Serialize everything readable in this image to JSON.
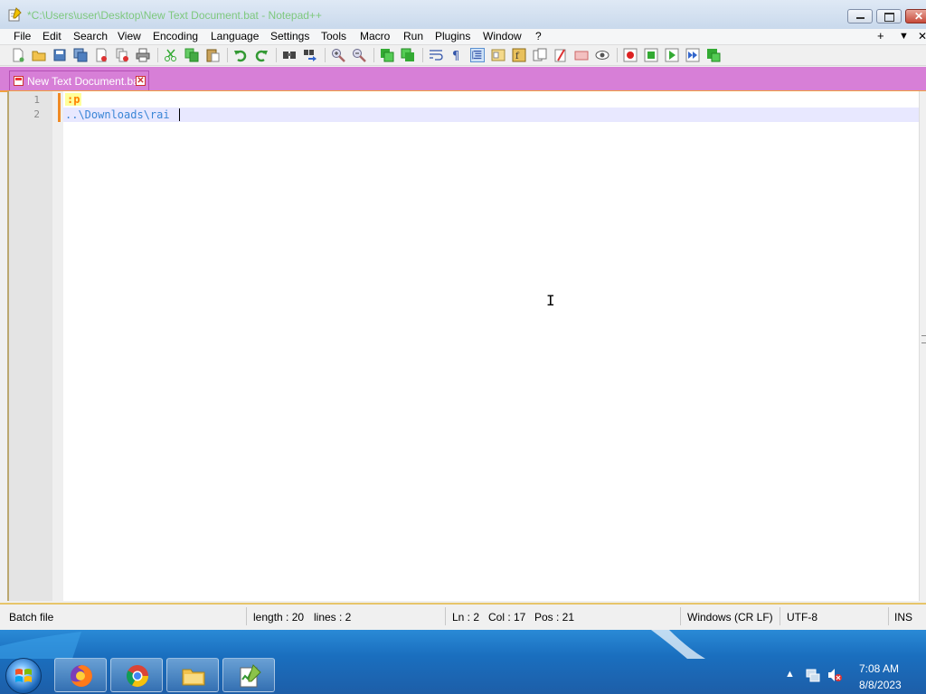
{
  "window": {
    "title": "*C:\\Users\\user\\Desktop\\New Text Document.bat - Notepad++",
    "minimize_icon": "minimize-icon",
    "maximize_icon": "maximize-icon",
    "close_icon": "close-icon"
  },
  "menu": {
    "items": [
      "File",
      "Edit",
      "Search",
      "View",
      "Encoding",
      "Language",
      "Settings",
      "Tools",
      "Macro",
      "Run",
      "Plugins",
      "Window",
      "?"
    ],
    "right_plus": "+",
    "right_down": "▼",
    "right_close": "✕"
  },
  "toolbar": {
    "icons": [
      "new-file-icon",
      "open-file-icon",
      "save-icon",
      "save-all-icon",
      "close-file-icon",
      "close-all-icon",
      "print-icon",
      "cut-icon",
      "copy-icon",
      "paste-icon",
      "undo-icon",
      "redo-icon",
      "find-icon",
      "replace-icon",
      "zoom-in-icon",
      "zoom-out-icon",
      "sync-vertical-icon",
      "sync-horizontal-icon",
      "word-wrap-icon",
      "show-all-chars-icon",
      "indent-guide-icon",
      "document-map-icon",
      "function-list-icon",
      "folder-as-workspace-icon",
      "monitoring-icon",
      "record-macro-icon",
      "stop-record-icon",
      "playback-macro-icon",
      "run-macro-multiple-icon",
      "save-macro-icon"
    ]
  },
  "tab": {
    "label": "New Text Document.bat",
    "close": "✕"
  },
  "editor": {
    "line_numbers": [
      "1",
      "2"
    ],
    "line1": ":p",
    "line2": "..\\Downloads\\rai"
  },
  "status": {
    "language": "Batch file",
    "length": "length : 20",
    "lines": "lines : 2",
    "ln": "Ln : 2",
    "col": "Col : 17",
    "pos": "Pos : 21",
    "eol": "Windows (CR LF)",
    "encoding": "UTF-8",
    "mode": "INS"
  },
  "taskbar": {
    "apps": [
      "firefox-icon",
      "chrome-icon",
      "file-explorer-icon",
      "notepadpp-icon"
    ],
    "tray_arrow": "▲",
    "time": "7:08 AM",
    "date": "8/8/2023"
  },
  "colors": {
    "tab_bar": "#d77fd7",
    "accent_orange": "#f2a13e",
    "title_text": "#7ec87e",
    "taskbar": "#1a6fbf"
  }
}
